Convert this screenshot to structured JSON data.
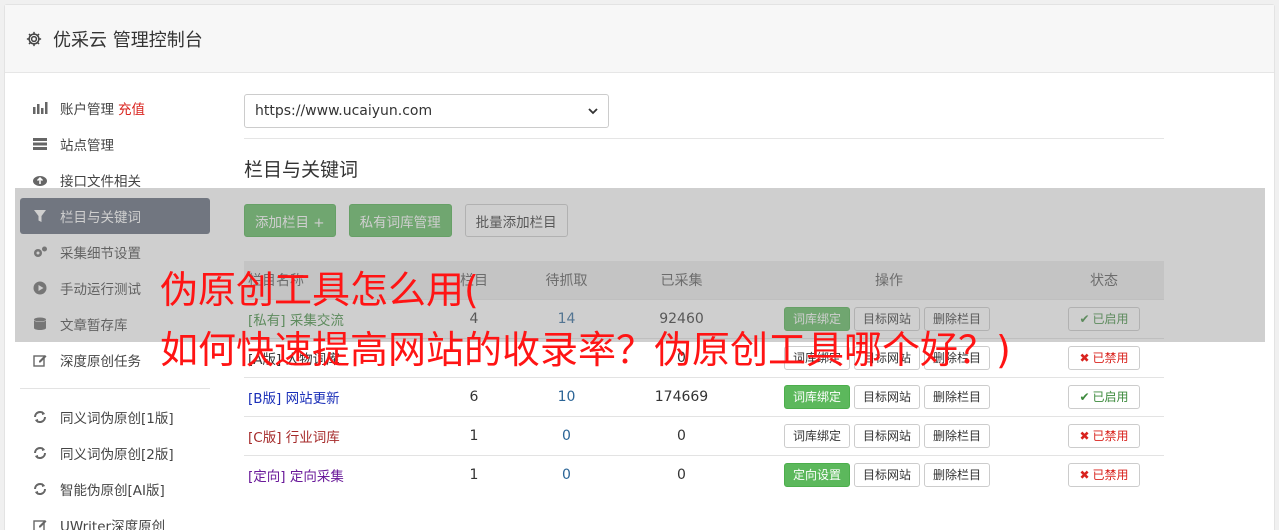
{
  "header": {
    "title": "优采云 管理控制台",
    "icon": "gear-icon"
  },
  "sidebar": {
    "items": [
      {
        "label": "账户管理",
        "extra": "充值",
        "icon": "bar-chart-icon"
      },
      {
        "label": "站点管理",
        "icon": "server-icon"
      },
      {
        "label": "接口文件相关",
        "icon": "cloud-upload-icon"
      },
      {
        "label": "栏目与关键词",
        "icon": "filter-icon",
        "active": true
      },
      {
        "label": "采集细节设置",
        "icon": "cogs-icon"
      },
      {
        "label": "手动运行测试",
        "icon": "play-circle-icon"
      },
      {
        "label": "文章暂存库",
        "icon": "database-icon"
      },
      {
        "label": "深度原创任务",
        "icon": "edit-icon"
      },
      {
        "label": "同义词伪原创[1版]",
        "icon": "refresh-icon"
      },
      {
        "label": "同义词伪原创[2版]",
        "icon": "refresh-icon"
      },
      {
        "label": "智能伪原创[AI版]",
        "icon": "refresh-icon"
      },
      {
        "label": "UWriter深度原创",
        "icon": "edit-icon"
      }
    ]
  },
  "main": {
    "site_select": "https://www.ucaiyun.com",
    "section_title": "栏目与关键词",
    "buttons": {
      "add_column": "添加栏目 +",
      "private_lib": "私有词库管理",
      "batch_add": "批量添加栏目"
    },
    "table": {
      "headers": [
        "栏目名称",
        "栏目",
        "待抓取",
        "已采集",
        "操作",
        "状态"
      ],
      "rows": [
        {
          "tag": "[私有]",
          "name": "采集交流",
          "cols": "4",
          "pending": "14",
          "collected": "92460",
          "action1": "词库绑定",
          "action2": "目标网站",
          "action3": "删除栏目",
          "status": "已启用",
          "tag_color": "#3c8a3c",
          "action1_primary": true,
          "status_on": true
        },
        {
          "tag": "[A版]",
          "name": "人物词库",
          "cols": "",
          "pending": "",
          "collected": "0",
          "action1": "词库绑定",
          "action2": "目标网站",
          "action3": "删除栏目",
          "status": "已禁用",
          "tag_color": "#333333",
          "action1_primary": false,
          "status_on": false
        },
        {
          "tag": "[B版]",
          "name": "网站更新",
          "cols": "6",
          "pending": "10",
          "collected": "174669",
          "action1": "词库绑定",
          "action2": "目标网站",
          "action3": "删除栏目",
          "status": "已启用",
          "tag_color": "#1a2fb8",
          "action1_primary": true,
          "status_on": true
        },
        {
          "tag": "[C版]",
          "name": "行业词库",
          "cols": "1",
          "pending": "0",
          "collected": "0",
          "action1": "词库绑定",
          "action2": "目标网站",
          "action3": "删除栏目",
          "status": "已禁用",
          "tag_color": "#a52a2a",
          "action1_primary": false,
          "status_on": false
        },
        {
          "tag": "[定向]",
          "name": "定向采集",
          "cols": "1",
          "pending": "0",
          "collected": "0",
          "action1": "定向设置",
          "action2": "目标网站",
          "action3": "删除栏目",
          "status": "已禁用",
          "tag_color": "#6a1a9a",
          "action1_primary": true,
          "status_on": false
        }
      ]
    }
  },
  "overlay": {
    "line1": "伪原创工具怎么用(",
    "line2": "如何快速提高网站的收录率？伪原创工具哪个好？)"
  }
}
